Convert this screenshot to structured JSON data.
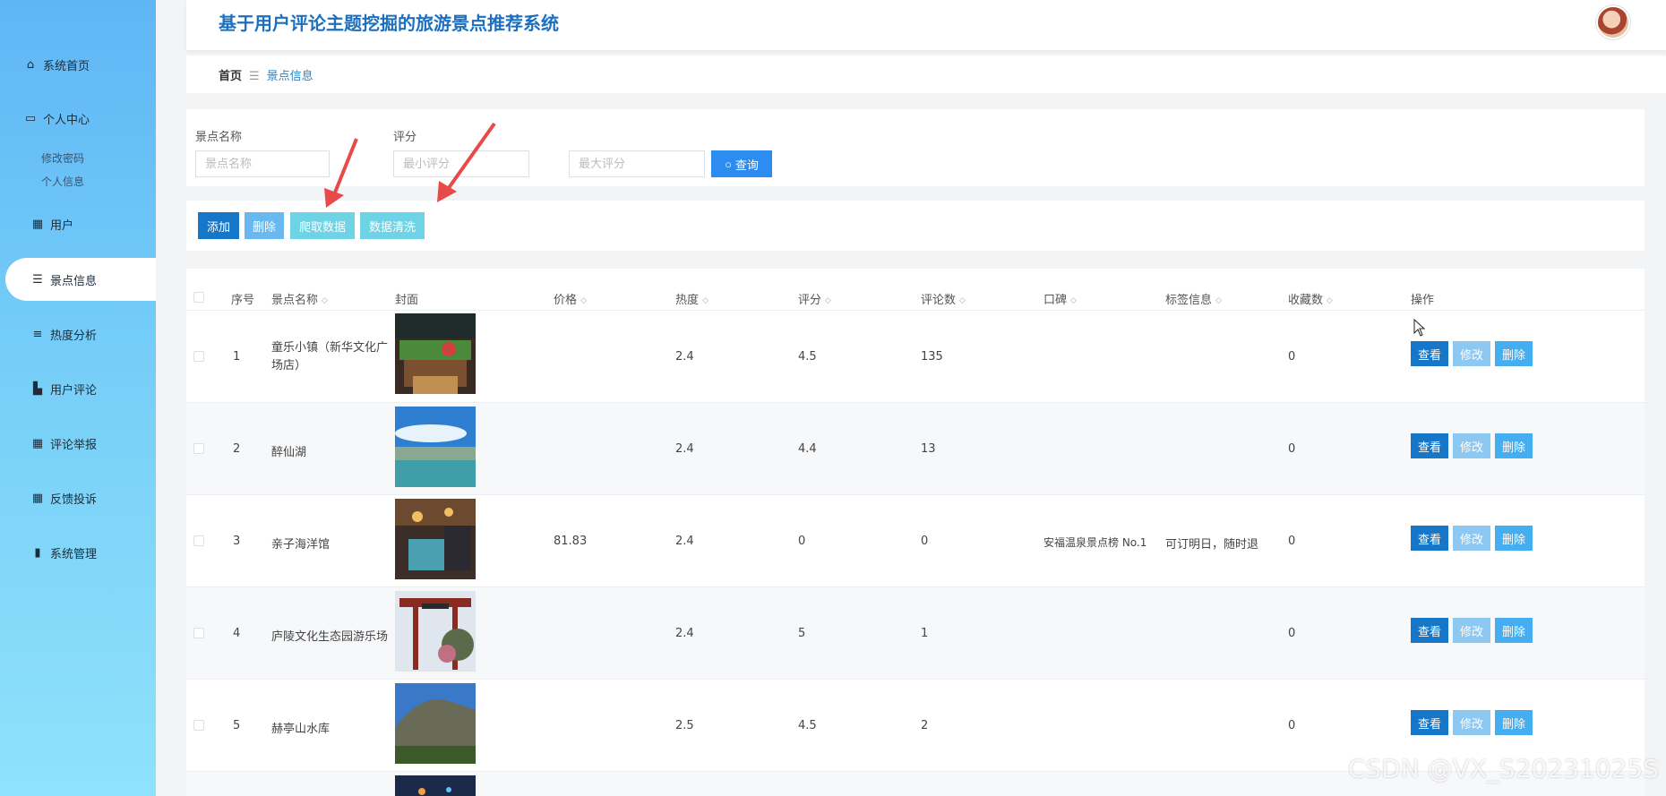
{
  "app": {
    "title": "基于用户评论主题挖掘的旅游景点推荐系统"
  },
  "sidebar": {
    "items": [
      {
        "label": "系统首页",
        "icon": "home-icon"
      },
      {
        "label": "个人中心",
        "icon": "card-icon"
      },
      {
        "label": "用户",
        "icon": "grid-icon"
      },
      {
        "label": "景点信息",
        "icon": "list-icon"
      },
      {
        "label": "热度分析",
        "icon": "sliders-icon"
      },
      {
        "label": "用户评论",
        "icon": "comment-icon"
      },
      {
        "label": "评论举报",
        "icon": "grid-icon"
      },
      {
        "label": "反馈投诉",
        "icon": "grid-icon"
      },
      {
        "label": "系统管理",
        "icon": "bar-chart-icon"
      }
    ],
    "subitems": [
      "修改密码",
      "个人信息"
    ],
    "active": "景点信息"
  },
  "breadcrumb": {
    "home": "首页",
    "current": "景点信息"
  },
  "search": {
    "name_label": "景点名称",
    "name_placeholder": "景点名称",
    "score_label": "评分",
    "min_placeholder": "最小评分",
    "max_placeholder": "最大评分",
    "query_label": "查询"
  },
  "actions": {
    "add": "添加",
    "delete": "删除",
    "crawl": "爬取数据",
    "clean": "数据清洗"
  },
  "table": {
    "headers": {
      "index": "序号",
      "name": "景点名称",
      "cover": "封面",
      "price": "价格",
      "heat": "热度",
      "score": "评分",
      "comments": "评论数",
      "reputation": "口碑",
      "tags": "标签信息",
      "favorites": "收藏数",
      "ops": "操作"
    },
    "rows": [
      {
        "index": "1",
        "name": "童乐小镇（新华文化广场店）",
        "price": "",
        "heat": "2.4",
        "score": "4.5",
        "comments": "135",
        "reputation": "",
        "tags": "",
        "favorites": "0"
      },
      {
        "index": "2",
        "name": "醉仙湖",
        "price": "",
        "heat": "2.4",
        "score": "4.4",
        "comments": "13",
        "reputation": "",
        "tags": "",
        "favorites": "0"
      },
      {
        "index": "3",
        "name": "亲子海洋馆",
        "price": "81.83",
        "heat": "2.4",
        "score": "0",
        "comments": "0",
        "reputation": "安福温泉景点榜 No.1",
        "tags": "可订明日，随时退",
        "favorites": "0"
      },
      {
        "index": "4",
        "name": "庐陵文化生态园游乐场",
        "price": "",
        "heat": "2.4",
        "score": "5",
        "comments": "1",
        "reputation": "",
        "tags": "",
        "favorites": "0"
      },
      {
        "index": "5",
        "name": "赫亭山水库",
        "price": "",
        "heat": "2.5",
        "score": "4.5",
        "comments": "2",
        "reputation": "",
        "tags": "",
        "favorites": "0"
      }
    ],
    "row_buttons": {
      "view": "查看",
      "edit": "修改",
      "delete": "删除"
    }
  },
  "watermark": "CSDN @VX_S20231025S",
  "colors": {
    "primary": "#2d8cf0",
    "dark_blue": "#1677c8",
    "light_blue": "#69b8f0",
    "cyan": "#6fd3e6",
    "title": "#1d6fbf"
  }
}
